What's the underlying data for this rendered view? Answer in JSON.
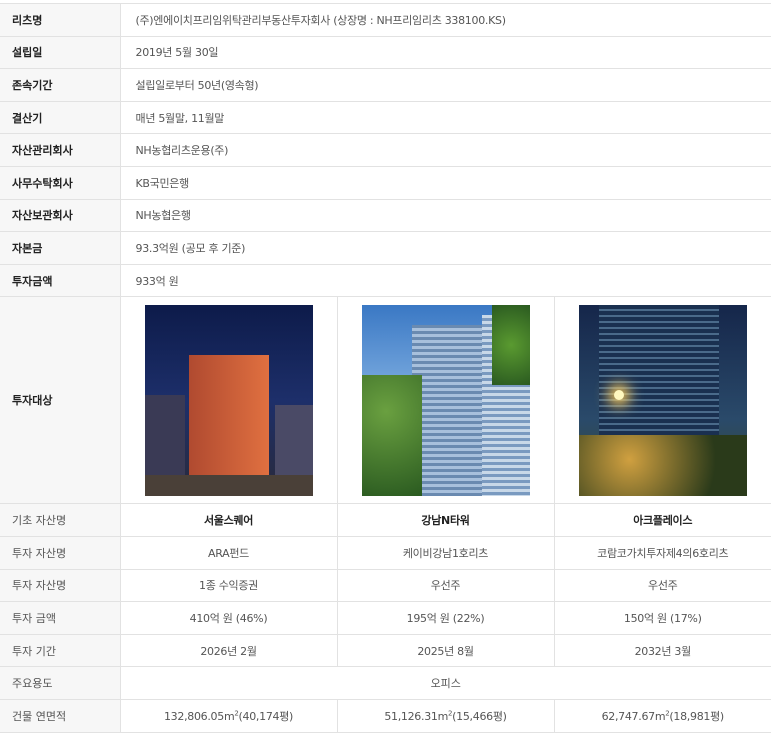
{
  "info": [
    {
      "label": "리츠명",
      "value": "(주)엔에이치프리임위탁관리부동산투자회사 (상장명 : NH프리임리츠 338100.KS)"
    },
    {
      "label": "설립일",
      "value": "2019년 5월 30일"
    },
    {
      "label": "존속기간",
      "value": "설립일로부터 50년(영속형)"
    },
    {
      "label": "결산기",
      "value": "매년 5월말, 11월말"
    },
    {
      "label": "자산관리회사",
      "value": "NH농협리츠운용(주)"
    },
    {
      "label": "사무수탁회사",
      "value": "KB국민은행"
    },
    {
      "label": "자산보관회사",
      "value": "NH농협은행"
    },
    {
      "label": "자본금",
      "value": "93.3억원 (공모 후 기준)"
    },
    {
      "label": "투자금액",
      "value": "933억 원"
    }
  ],
  "targets_label": "투자대상",
  "assets": {
    "rows": [
      {
        "label": "기초 자산명",
        "values": [
          "서울스퀘어",
          "강남N타워",
          "아크플레이스"
        ]
      },
      {
        "label": "투자 자산명",
        "values": [
          "ARA펀드",
          "케이비강남1호리츠",
          "코람코가치투자제4의6호리츠"
        ]
      },
      {
        "label": "투자 자산명",
        "values": [
          "1종 수익증권",
          "우선주",
          "우선주"
        ]
      },
      {
        "label": "투자 금액",
        "values": [
          "410억 원 (46%)",
          "195억 원 (22%)",
          "150억 원 (17%)"
        ]
      },
      {
        "label": "투자 기간",
        "values": [
          "2026년 2월",
          "2025년 8월",
          "2032년 3월"
        ]
      }
    ],
    "usage": {
      "label": "주요용도",
      "value": "오피스"
    },
    "area": {
      "label": "건물 연면적",
      "values": [
        {
          "m2": "132,806.05m",
          "sup": "2",
          "pyeong": "(40,174평)"
        },
        {
          "m2": "51,126.31m",
          "sup": "2",
          "pyeong": "(15,466평)"
        },
        {
          "m2": "62,747.67m",
          "sup": "2",
          "pyeong": "(18,981평)"
        }
      ]
    }
  }
}
